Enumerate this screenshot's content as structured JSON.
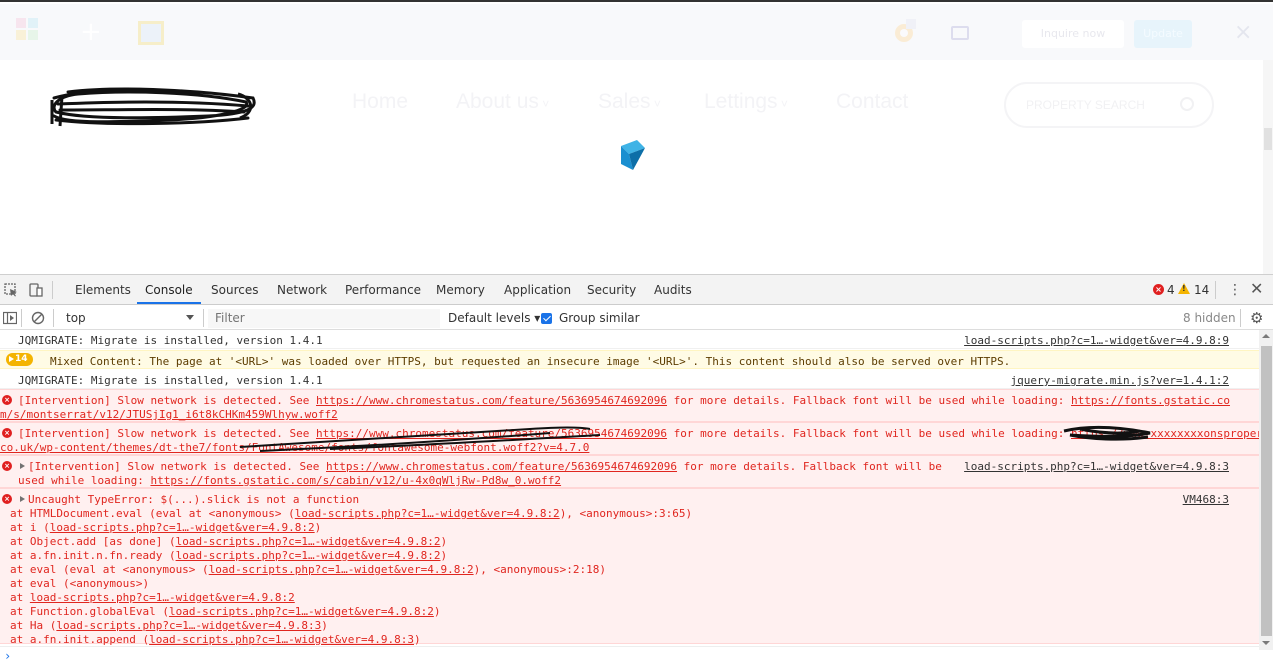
{
  "site": {
    "toolbar": {
      "plus_icon": "+",
      "button_light": "Inquire now",
      "button_blue": "Update",
      "close_icon": "×"
    },
    "nav": [
      {
        "label": "Home"
      },
      {
        "label": "About us"
      },
      {
        "label": "Sales"
      },
      {
        "label": "Lettings"
      },
      {
        "label": "Contact"
      }
    ],
    "property_search": "PROPERTY SEARCH"
  },
  "devtools": {
    "tabs": [
      "Elements",
      "Console",
      "Sources",
      "Network",
      "Performance",
      "Memory",
      "Application",
      "Security",
      "Audits"
    ],
    "active_tab": "Console",
    "error_count": "4",
    "warning_count": "14",
    "context": "top",
    "filter_placeholder": "Filter",
    "default_levels": "Default levels ▾",
    "group_similar": "Group similar",
    "hidden": "8 hidden",
    "colors": {
      "error": "#e0261f",
      "warning": "#f4b400",
      "accent": "#1a73e8"
    }
  },
  "console": {
    "m1": {
      "text": "JQMIGRATE: Migrate is installed, version 1.4.1",
      "source": "load-scripts.php?c=1…-widget&ver=4.9.8:9"
    },
    "m2": {
      "count": "14",
      "text": "Mixed Content: The page at '<URL>' was loaded over HTTPS, but requested an insecure image '<URL>'. This content should also be served over HTTPS."
    },
    "m3": {
      "text": "JQMIGRATE: Migrate is installed, version 1.4.1",
      "source": "jquery-migrate.min.js?ver=1.4.1:2"
    },
    "m4": {
      "pre": "[Intervention] Slow network is detected. See ",
      "link": "https://www.chromestatus.com/feature/5636954674692096",
      "mid": " for more details. Fallback font will be used while loading: ",
      "font1": "https://fonts.gstatic.co",
      "font2": "m/s/montserrat/v12/JTUSjIg1_i6t8kCHKm459Wlhyw.woff2"
    },
    "m5": {
      "pre": "[Intervention] Slow network is detected. See ",
      "link": "https://www.chromestatus.com/feature/5636954674692096",
      "mid": " for more details. Fallback font will be used while loading: ",
      "font1": "https://www.xxxxxxxxonsproperty.",
      "font2": "co.uk/wp-content/themes/dt-the7/fonts/FontAwesome/fonts/fontawesome-webfont.woff2?v=4.7.0"
    },
    "m6": {
      "pre": "[Intervention] Slow network is detected. See ",
      "link": "https://www.chromestatus.com/feature/5636954674692096",
      "mid": " for more details. Fallback font will be",
      "line2_pre": "used while loading: ",
      "font": "https://fonts.gstatic.com/s/cabin/v12/u-4x0qWljRw-Pd8w_0.woff2",
      "source": "load-scripts.php?c=1…-widget&ver=4.9.8:3"
    },
    "m7": {
      "head": "Uncaught TypeError: $(...).slick is not a function",
      "source": "VM468:3",
      "stack": [
        {
          "pre": "    at HTMLDocument.eval (eval at <anonymous> (",
          "link": "load-scripts.php?c=1…-widget&ver=4.9.8:2",
          "post": "), <anonymous>:3:65)"
        },
        {
          "pre": "    at i (",
          "link": "load-scripts.php?c=1…-widget&ver=4.9.8:2",
          "post": ")"
        },
        {
          "pre": "    at Object.add [as done] (",
          "link": "load-scripts.php?c=1…-widget&ver=4.9.8:2",
          "post": ")"
        },
        {
          "pre": "    at a.fn.init.n.fn.ready (",
          "link": "load-scripts.php?c=1…-widget&ver=4.9.8:2",
          "post": ")"
        },
        {
          "pre": "    at eval (eval at <anonymous> (",
          "link": "load-scripts.php?c=1…-widget&ver=4.9.8:2",
          "post": "), <anonymous>:2:18)"
        },
        {
          "pre": "    at eval (<anonymous>)",
          "link": "",
          "post": ""
        },
        {
          "pre": "    at ",
          "link": "load-scripts.php?c=1…-widget&ver=4.9.8:2",
          "post": ""
        },
        {
          "pre": "    at Function.globalEval (",
          "link": "load-scripts.php?c=1…-widget&ver=4.9.8:2",
          "post": ")"
        },
        {
          "pre": "    at Ha (",
          "link": "load-scripts.php?c=1…-widget&ver=4.9.8:3",
          "post": ")"
        },
        {
          "pre": "    at a.fn.init.append (",
          "link": "load-scripts.php?c=1…-widget&ver=4.9.8:3",
          "post": ")"
        }
      ]
    },
    "prompt": "›"
  }
}
